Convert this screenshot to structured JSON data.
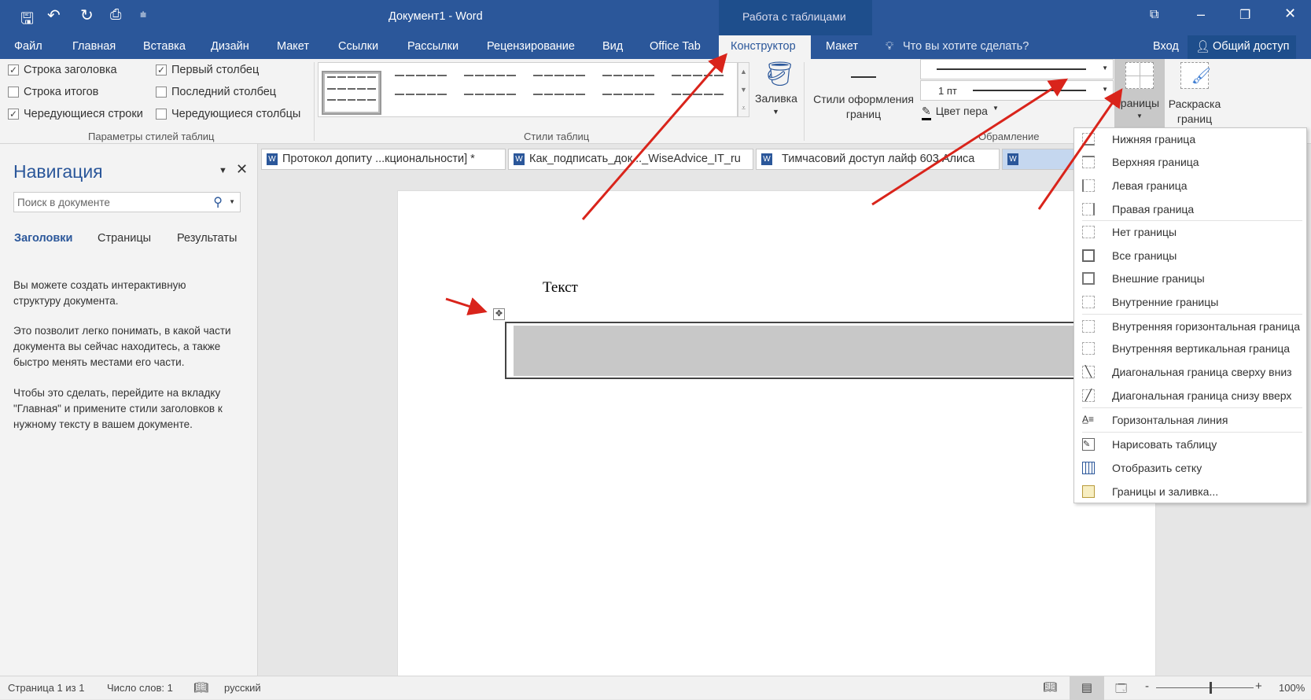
{
  "window": {
    "title": "Документ1 - Word",
    "context_tab_group": "Работа с таблицами"
  },
  "quick_access": {
    "icons": [
      "save-icon",
      "undo-icon",
      "redo-icon",
      "print-preview-icon",
      "customize-icon"
    ]
  },
  "tabs": [
    "Файл",
    "Главная",
    "Вставка",
    "Дизайн",
    "Макет",
    "Ссылки",
    "Рассылки",
    "Рецензирование",
    "Вид",
    "Office Tab",
    "Конструктор",
    "Макет"
  ],
  "active_tab": "Конструктор",
  "tell_me": "Что вы хотите сделать?",
  "sign_in": "Вход",
  "share": "Общий доступ",
  "ribbon": {
    "style_options": {
      "items": [
        {
          "label": "Строка заголовка",
          "checked": true
        },
        {
          "label": "Строка итогов",
          "checked": false
        },
        {
          "label": "Чередующиеся строки",
          "checked": true
        },
        {
          "label": "Первый столбец",
          "checked": true
        },
        {
          "label": "Последний столбец",
          "checked": false
        },
        {
          "label": "Чередующиеся столбцы",
          "checked": false
        }
      ],
      "group_label": "Параметры стилей таблиц"
    },
    "table_styles_label": "Стили таблиц",
    "shading": "Заливка",
    "border_styles": "Стили оформления границ",
    "line_weight": "1 пт",
    "pen_color": "Цвет пера",
    "borders": "Границы",
    "border_painter": "Раскраска границ",
    "borders_group_label": "Обрамление"
  },
  "doc_tabs": [
    "Протокол допиту ...кционaльности] *",
    "Как_подписать_док..._WiseAdvice_IT_ru",
    "Тимчасовий доступ лайф 603 Алиса"
  ],
  "nav": {
    "title": "Навигация",
    "search_placeholder": "Поиск в документе",
    "tabs": [
      "Заголовки",
      "Страницы",
      "Результаты"
    ],
    "p1": "Вы можете создать интерактивную структуру документа.",
    "p2": "Это позволит легко понимать, в какой части документа вы сейчас находитесь, а также быстро менять местами его части.",
    "p3": "Чтобы это сделать, перейдите на вкладку \"Главная\" и примените стили заголовков к нужному тексту в вашем документе."
  },
  "document": {
    "text": "Текст"
  },
  "borders_menu": [
    "Нижняя граница",
    "Верхняя граница",
    "Левая граница",
    "Правая граница",
    "Нет границы",
    "Все границы",
    "Внешние границы",
    "Внутренние границы",
    "Внутренняя горизонтальная граница",
    "Внутренняя вертикальная граница",
    "Диагональная граница сверху вниз",
    "Диагональная граница снизу вверх",
    "Горизонтальная линия",
    "Нарисовать таблицу",
    "Отобразить сетку",
    "Границы и заливка..."
  ],
  "status": {
    "page": "Страница 1 из 1",
    "words": "Число слов: 1",
    "language": "русский",
    "zoom": "100%",
    "zoom_percent": 100
  },
  "colors": {
    "brand": "#2b579a",
    "arrow": "#d9241b"
  }
}
